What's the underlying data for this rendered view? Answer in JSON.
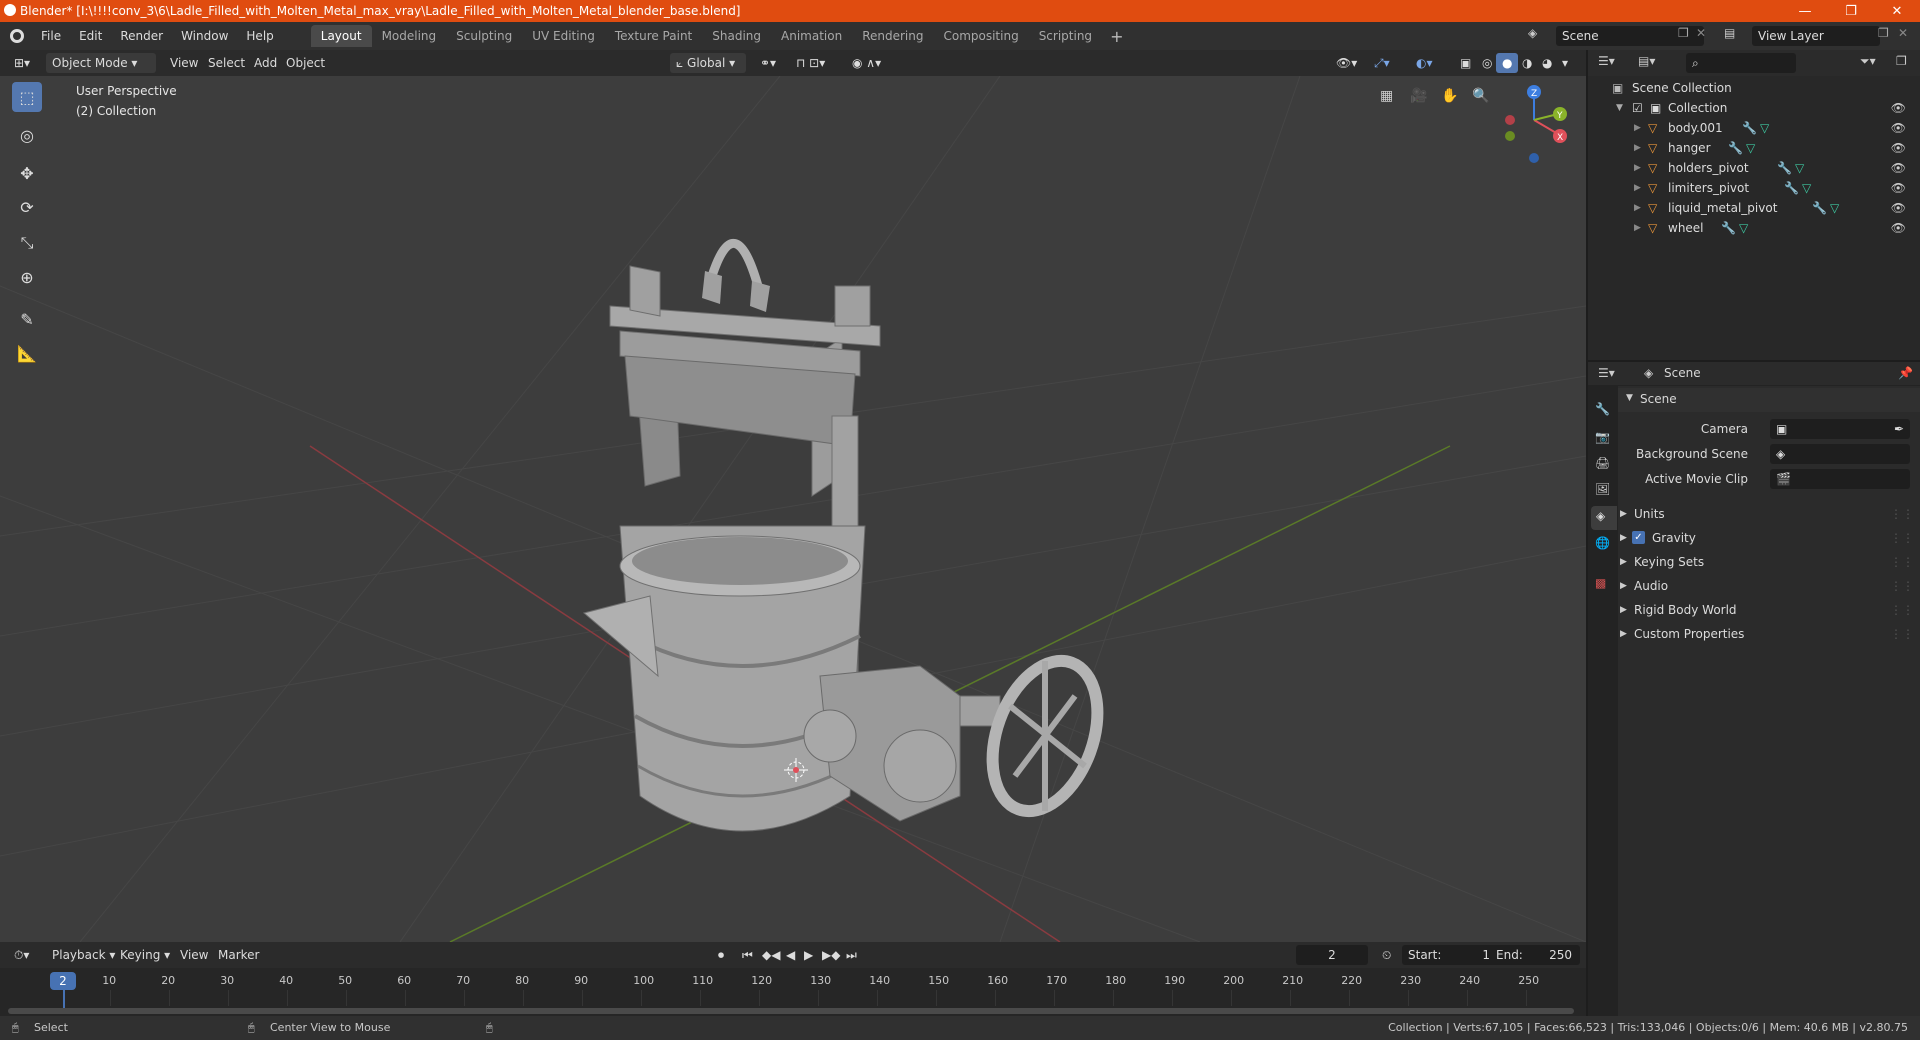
{
  "window": {
    "title": "Blender* [I:\\!!!!conv_3\\6\\Ladle_Filled_with_Molten_Metal_max_vray\\Ladle_Filled_with_Molten_Metal_blender_base.blend]",
    "controls": [
      "—",
      "❐",
      "✕"
    ]
  },
  "menu": [
    "File",
    "Edit",
    "Render",
    "Window",
    "Help"
  ],
  "workspaces": [
    {
      "label": "Layout",
      "active": true
    },
    {
      "label": "Modeling",
      "active": false
    },
    {
      "label": "Sculpting",
      "active": false
    },
    {
      "label": "UV Editing",
      "active": false
    },
    {
      "label": "Texture Paint",
      "active": false
    },
    {
      "label": "Shading",
      "active": false
    },
    {
      "label": "Animation",
      "active": false
    },
    {
      "label": "Rendering",
      "active": false
    },
    {
      "label": "Compositing",
      "active": false
    },
    {
      "label": "Scripting",
      "active": false
    }
  ],
  "scene_field": "Scene",
  "view_layer_field": "View Layer",
  "viewport_header": {
    "mode": "Object Mode",
    "menus": [
      "View",
      "Select",
      "Add",
      "Object"
    ],
    "orientation": "Global"
  },
  "viewport": {
    "perspective_label": "User Perspective",
    "collection_label": "(2) Collection",
    "gizmo_axes": {
      "x": "X",
      "y": "Y",
      "z": "Z"
    },
    "colors": {
      "x_axis": "#e0505a",
      "y_axis": "#8ab32a",
      "z_axis": "#3d7ee0",
      "background": "#3d3d3d"
    }
  },
  "outliner": {
    "scene_collection": "Scene Collection",
    "collection": "Collection",
    "objects": [
      "body.001",
      "hanger",
      "holders_pivot",
      "limiters_pivot",
      "liquid_metal_pivot",
      "wheel"
    ]
  },
  "properties": {
    "header": "Scene",
    "section": "Scene",
    "fields": {
      "camera": "Camera",
      "background_scene": "Background Scene",
      "active_movie_clip": "Active Movie Clip"
    },
    "subpanels": [
      {
        "label": "Units",
        "checkbox": false
      },
      {
        "label": "Gravity",
        "checkbox": true
      },
      {
        "label": "Keying Sets",
        "checkbox": false
      },
      {
        "label": "Audio",
        "checkbox": false
      },
      {
        "label": "Rigid Body World",
        "checkbox": false
      },
      {
        "label": "Custom Properties",
        "checkbox": false
      }
    ]
  },
  "timeline": {
    "menus": [
      "Playback",
      "Keying",
      "View",
      "Marker"
    ],
    "current_frame": "2",
    "start_label": "Start:",
    "start": "1",
    "end_label": "End:",
    "end": "250",
    "ruler": [
      "10",
      "20",
      "30",
      "40",
      "50",
      "60",
      "70",
      "80",
      "90",
      "100",
      "110",
      "120",
      "130",
      "140",
      "150",
      "160",
      "170",
      "180",
      "190",
      "200",
      "210",
      "220",
      "230",
      "240",
      "250"
    ],
    "playhead": "2"
  },
  "statusbar": {
    "select": "Select",
    "center_view": "Center View to Mouse",
    "stats": "Collection | Verts:67,105 | Faces:66,523 | Tris:133,046 | Objects:0/6 | Mem: 40.6 MB | v2.80.75"
  }
}
